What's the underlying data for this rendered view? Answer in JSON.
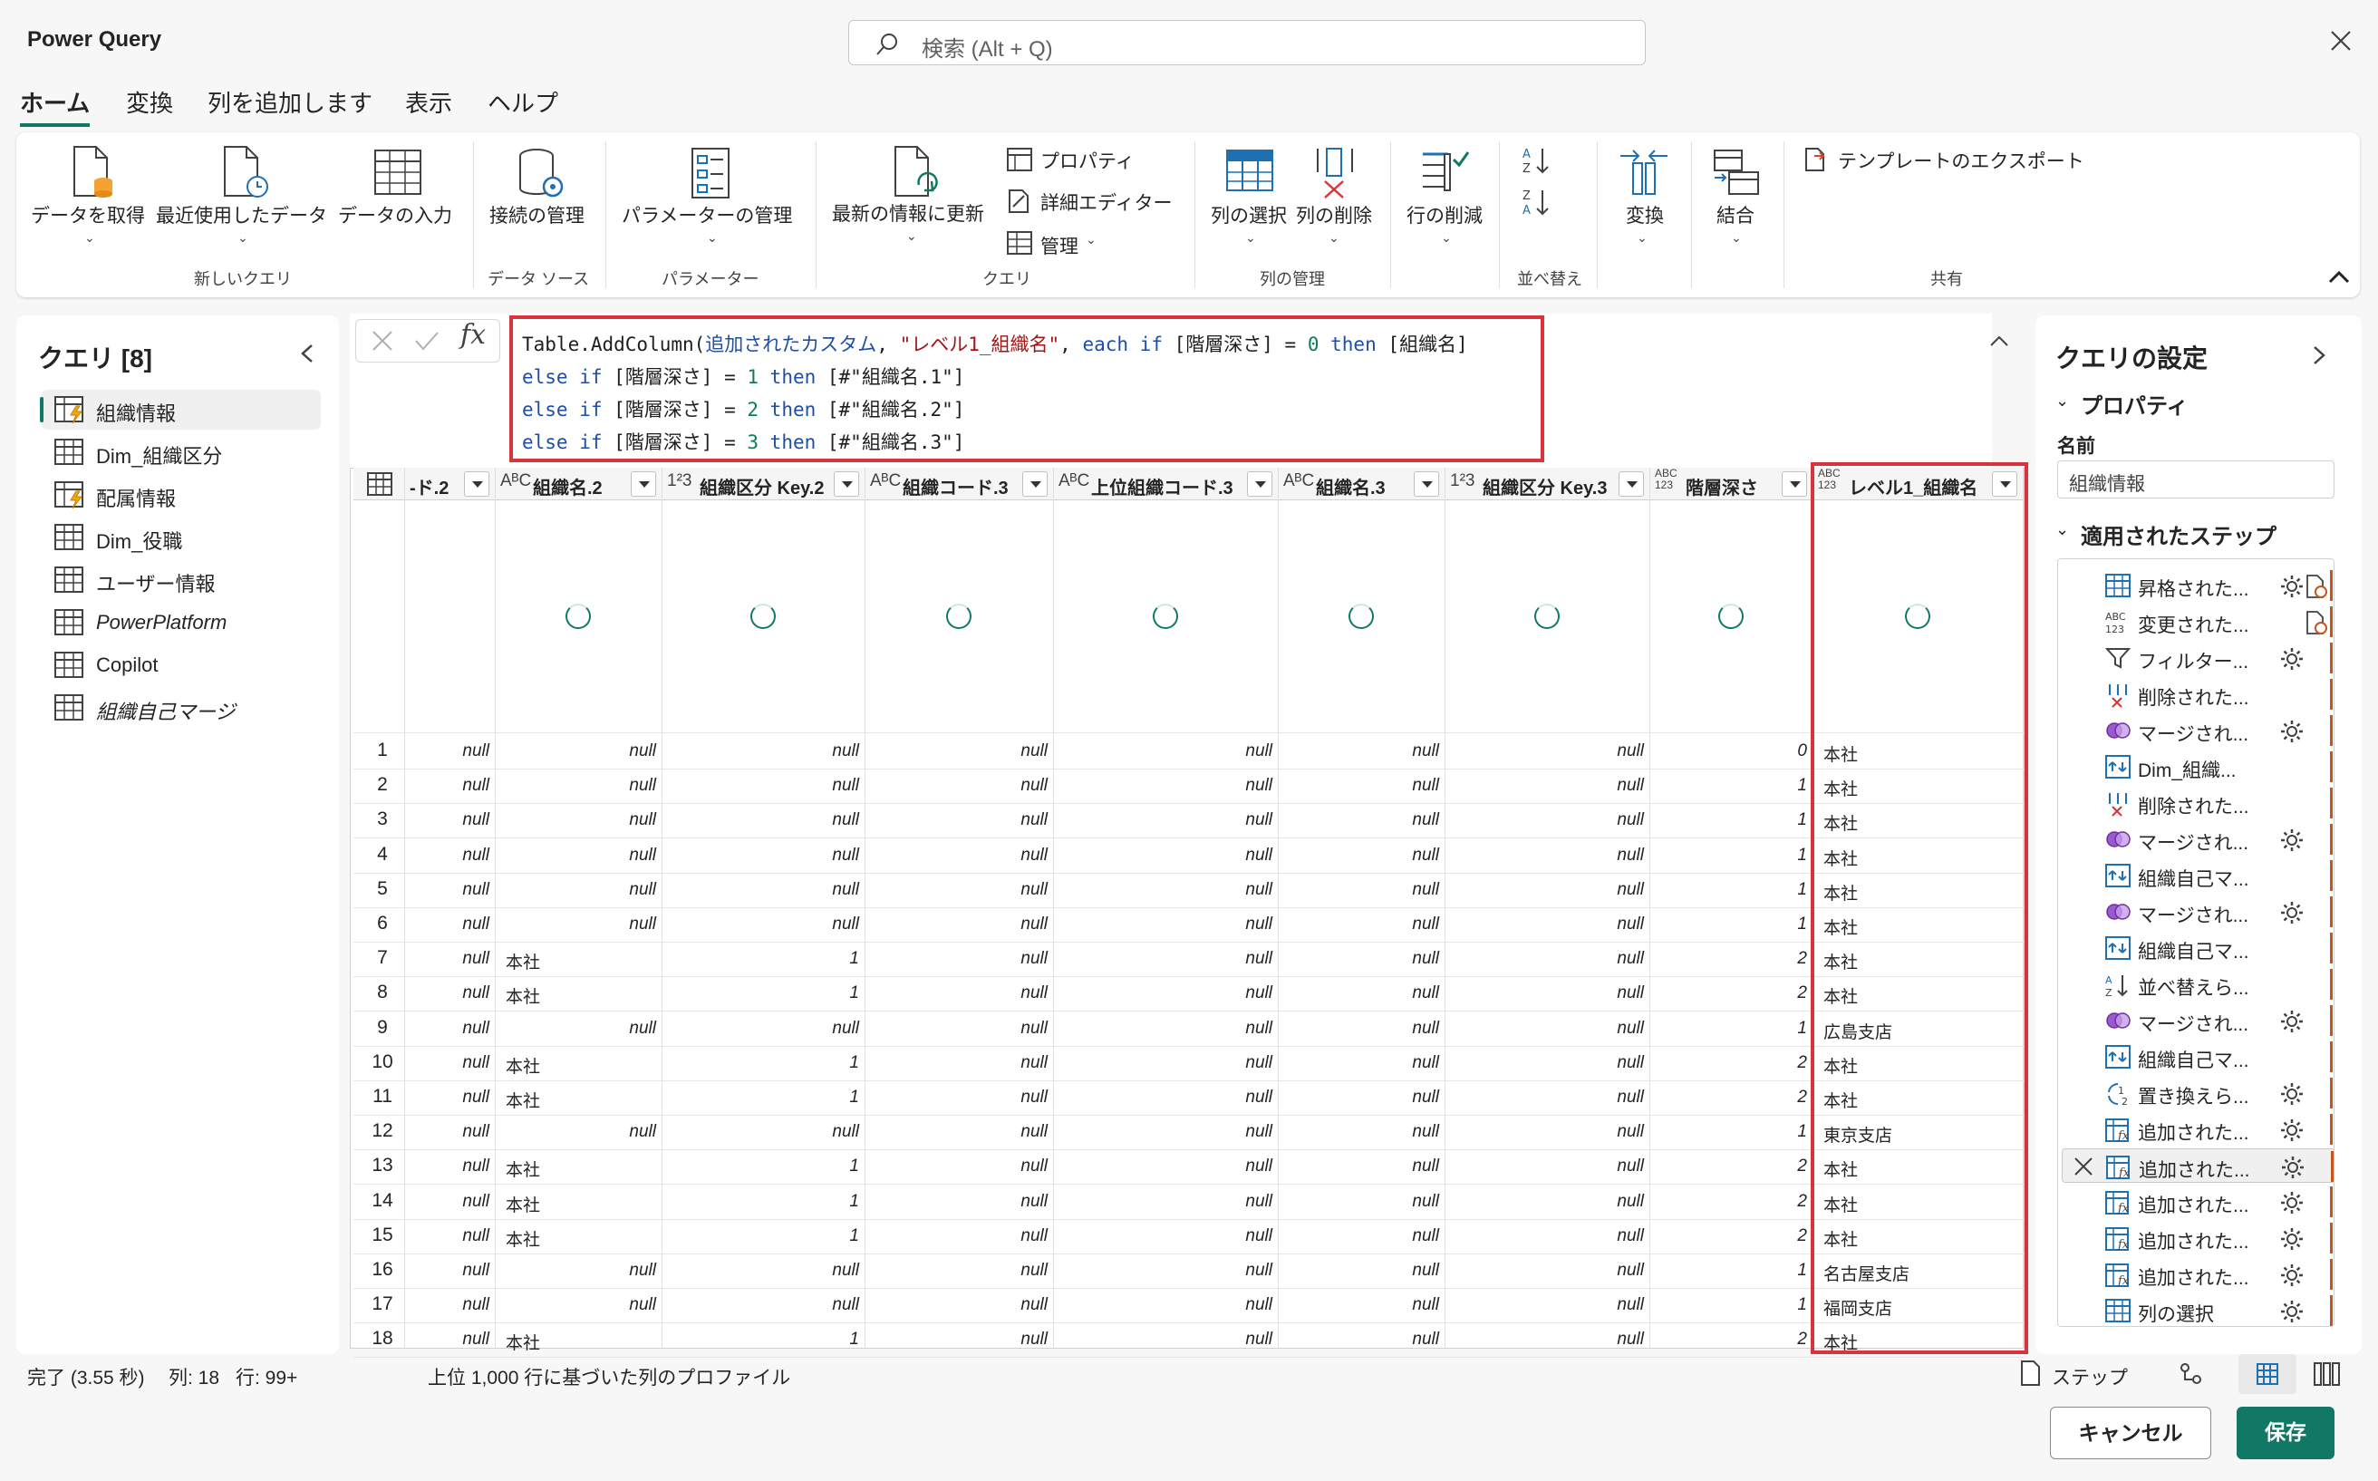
{
  "app": {
    "title": "Power Query",
    "search_placeholder": "検索 (Alt + Q)"
  },
  "tabs": [
    "ホーム",
    "変換",
    "列を追加します",
    "表示",
    "ヘルプ"
  ],
  "ribbon": {
    "get_data": "データを取得",
    "recent": "最近使用したデータ",
    "enter_data": "データの入力",
    "group_new_query": "新しいクエリ",
    "manage_connections": "接続の管理",
    "group_data_source": "データ ソース",
    "manage_params": "パラメーターの管理",
    "group_params": "パラメーター",
    "refresh": "最新の情報に更新",
    "properties": "プロパティ",
    "advanced_editor": "詳細エディター",
    "manage": "管理",
    "group_query": "クエリ",
    "choose_cols": "列の選択",
    "remove_cols": "列の削除",
    "group_manage_cols": "列の管理",
    "reduce_rows": "行の削減",
    "group_sort": "並べ替え",
    "transform": "変換",
    "combine": "結合",
    "export_template": "テンプレートのエクスポート",
    "group_share": "共有"
  },
  "queries": {
    "title": "クエリ [8]",
    "items": [
      {
        "label": "組織情報",
        "italic": false
      },
      {
        "label": "Dim_組織区分",
        "italic": false
      },
      {
        "label": "配属情報",
        "italic": false
      },
      {
        "label": "Dim_役職",
        "italic": false
      },
      {
        "label": "ユーザー情報",
        "italic": false
      },
      {
        "label": "PowerPlatform",
        "italic": true
      },
      {
        "label": "Copilot",
        "italic": false
      },
      {
        "label": "組織自己マージ",
        "italic": true
      }
    ]
  },
  "formula": {
    "line1_a": "Table.AddColumn(",
    "line1_b": "追加されたカスタム",
    "line1_c": ", ",
    "line1_d": "\"レベル1_組織名\"",
    "line1_e": ", ",
    "line1_f": "each if",
    "line1_g": " [階層深さ] = ",
    "line1_h": "0",
    "line1_i": " then",
    "line1_j": " [組織名]",
    "line2_kw": "else if",
    "line2_a": " [階層深さ] = ",
    "line2_n": "1",
    "line2_t": " then",
    "line2_b": " [#\"組織名.1\"]",
    "line3_kw": "else if",
    "line3_a": " [階層深さ] = ",
    "line3_n": "2",
    "line3_t": " then",
    "line3_b": " [#\"組織名.2\"]",
    "line4_kw": "else if",
    "line4_a": " [階層深さ] = ",
    "line4_n": "3",
    "line4_t": " then",
    "line4_b": " [#\"組織名.3\"]"
  },
  "grid": {
    "columns": [
      {
        "type": "",
        "name": "-ド.2"
      },
      {
        "type": "ABC",
        "name": "組織名.2"
      },
      {
        "type": "123",
        "name": "組織区分 Key.2"
      },
      {
        "type": "ABC",
        "name": "組織コード.3"
      },
      {
        "type": "ABC",
        "name": "上位組織コード.3"
      },
      {
        "type": "ABC",
        "name": "組織名.3"
      },
      {
        "type": "123",
        "name": "組織区分 Key.3"
      },
      {
        "type": "ABC123",
        "name": "階層深さ"
      },
      {
        "type": "ABC123",
        "name": "レベル1_組織名"
      }
    ],
    "rows": [
      [
        "1",
        "null",
        "null",
        "null",
        "null",
        "null",
        "null",
        "null",
        "0",
        "本社"
      ],
      [
        "2",
        "null",
        "null",
        "null",
        "null",
        "null",
        "null",
        "null",
        "1",
        "本社"
      ],
      [
        "3",
        "null",
        "null",
        "null",
        "null",
        "null",
        "null",
        "null",
        "1",
        "本社"
      ],
      [
        "4",
        "null",
        "null",
        "null",
        "null",
        "null",
        "null",
        "null",
        "1",
        "本社"
      ],
      [
        "5",
        "null",
        "null",
        "null",
        "null",
        "null",
        "null",
        "null",
        "1",
        "本社"
      ],
      [
        "6",
        "null",
        "null",
        "null",
        "null",
        "null",
        "null",
        "null",
        "1",
        "本社"
      ],
      [
        "7",
        "null",
        "本社",
        "1",
        "null",
        "null",
        "null",
        "null",
        "2",
        "本社"
      ],
      [
        "8",
        "null",
        "本社",
        "1",
        "null",
        "null",
        "null",
        "null",
        "2",
        "本社"
      ],
      [
        "9",
        "null",
        "null",
        "null",
        "null",
        "null",
        "null",
        "null",
        "1",
        "広島支店"
      ],
      [
        "10",
        "null",
        "本社",
        "1",
        "null",
        "null",
        "null",
        "null",
        "2",
        "本社"
      ],
      [
        "11",
        "null",
        "本社",
        "1",
        "null",
        "null",
        "null",
        "null",
        "2",
        "本社"
      ],
      [
        "12",
        "null",
        "null",
        "null",
        "null",
        "null",
        "null",
        "null",
        "1",
        "東京支店"
      ],
      [
        "13",
        "null",
        "本社",
        "1",
        "null",
        "null",
        "null",
        "null",
        "2",
        "本社"
      ],
      [
        "14",
        "null",
        "本社",
        "1",
        "null",
        "null",
        "null",
        "null",
        "2",
        "本社"
      ],
      [
        "15",
        "null",
        "本社",
        "1",
        "null",
        "null",
        "null",
        "null",
        "2",
        "本社"
      ],
      [
        "16",
        "null",
        "null",
        "null",
        "null",
        "null",
        "null",
        "null",
        "1",
        "名古屋支店"
      ],
      [
        "17",
        "null",
        "null",
        "null",
        "null",
        "null",
        "null",
        "null",
        "1",
        "福岡支店"
      ],
      [
        "18",
        "null",
        "本社",
        "1",
        "null",
        "null",
        "null",
        "null",
        "2",
        "本社"
      ]
    ]
  },
  "settings": {
    "title": "クエリの設定",
    "properties": "プロパティ",
    "name_label": "名前",
    "name_value": "組織情報",
    "applied_steps": "適用されたステップ",
    "steps": [
      {
        "label": "昇格された...",
        "icon": "table",
        "gear": true
      },
      {
        "label": "変更された...",
        "icon": "abc",
        "gear": false
      },
      {
        "label": "フィルター...",
        "icon": "filter",
        "gear": true
      },
      {
        "label": "削除された...",
        "icon": "remove",
        "gear": false
      },
      {
        "label": "マージされ...",
        "icon": "merge",
        "gear": true
      },
      {
        "label": "Dim_組織...",
        "icon": "expand",
        "gear": false
      },
      {
        "label": "削除された...",
        "icon": "remove",
        "gear": false
      },
      {
        "label": "マージされ...",
        "icon": "merge",
        "gear": true
      },
      {
        "label": "組織自己マ...",
        "icon": "expand",
        "gear": false
      },
      {
        "label": "マージされ...",
        "icon": "merge",
        "gear": true
      },
      {
        "label": "組織自己マ...",
        "icon": "expand",
        "gear": false
      },
      {
        "label": "並べ替えら...",
        "icon": "sort",
        "gear": false
      },
      {
        "label": "マージされ...",
        "icon": "merge",
        "gear": true
      },
      {
        "label": "組織自己マ...",
        "icon": "expand",
        "gear": false
      },
      {
        "label": "置き換えら...",
        "icon": "replace",
        "gear": true
      },
      {
        "label": "追加された...",
        "icon": "custom",
        "gear": true
      },
      {
        "label": "追加された...",
        "icon": "custom",
        "gear": true
      },
      {
        "label": "追加された...",
        "icon": "custom",
        "gear": true
      },
      {
        "label": "追加された...",
        "icon": "custom",
        "gear": true
      },
      {
        "label": "追加された...",
        "icon": "custom",
        "gear": true
      },
      {
        "label": "列の選択",
        "icon": "table",
        "gear": true
      }
    ]
  },
  "status": {
    "done": "完了 (3.55 秒)",
    "cols": "列: 18",
    "rows": "行: 99+",
    "profile": "上位 1,000 行に基づいた列のプロファイル",
    "step_label": "ステップ"
  },
  "buttons": {
    "cancel": "キャンセル",
    "save": "保存"
  },
  "colors": {
    "accent": "#117865",
    "highlight": "#d9343c",
    "step_bar": "#c8541c"
  }
}
